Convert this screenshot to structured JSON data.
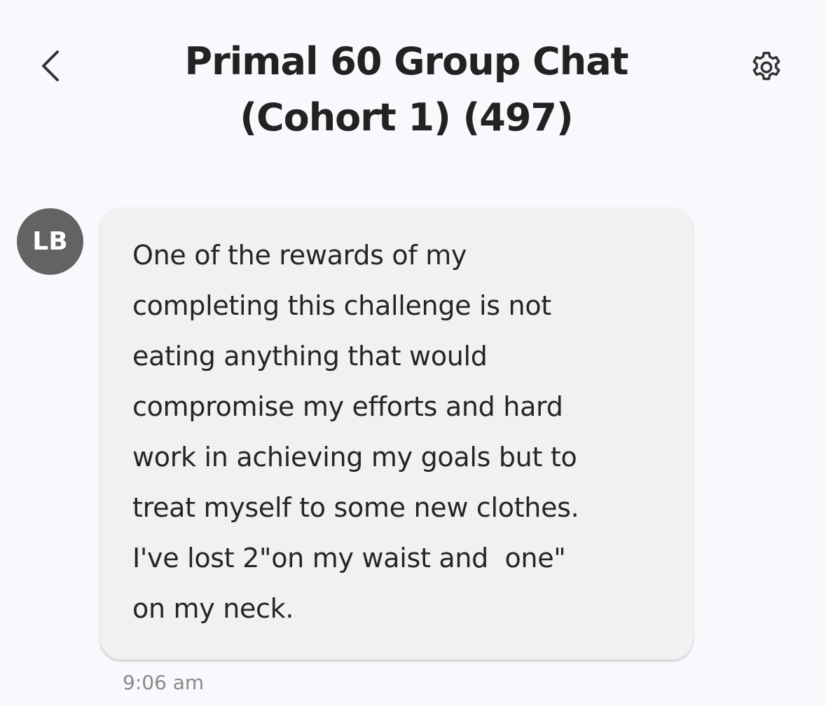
{
  "header": {
    "title": "Primal 60 Group Chat (Cohort 1) (497)",
    "back_icon": "chevron-left-icon",
    "settings_icon": "gear-icon"
  },
  "message": {
    "sender_initials": "LB",
    "text": "One of the rewards of my\ncompleting this challenge is not\neating anything that would\ncompromise my efforts and hard\nwork in achieving my goals but to\ntreat myself to some new clothes.\nI've lost 2\"on my waist and  one\"\non my neck.",
    "time": "9:06 am"
  },
  "colors": {
    "background": "#f8f9fd",
    "bubble": "#f1f1f1",
    "avatar": "#636363",
    "text": "#222222",
    "timestamp": "#8a8a8a"
  }
}
